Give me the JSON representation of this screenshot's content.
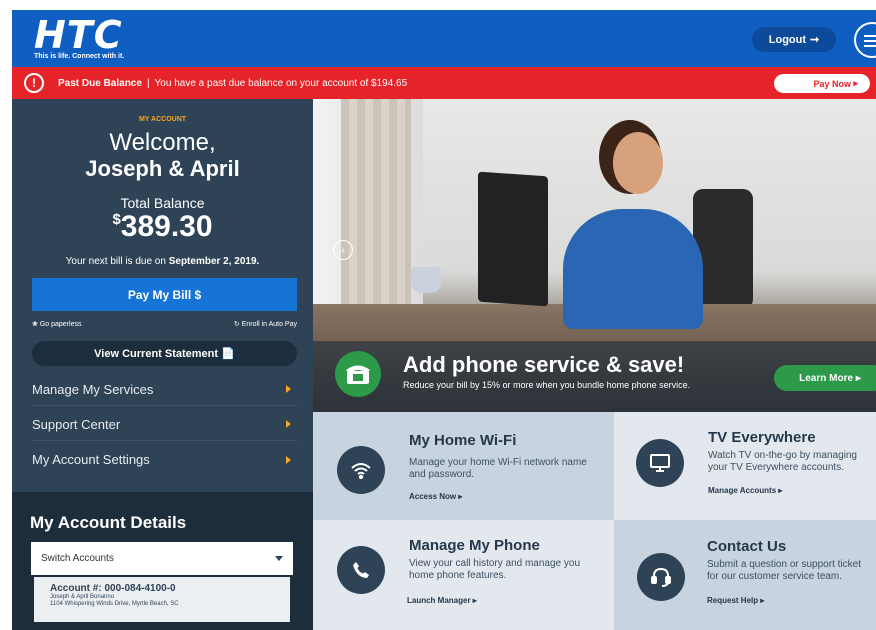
{
  "header": {
    "logo_text": "HTC",
    "tagline": "This is life. Connect with it.",
    "logout_label": "Logout"
  },
  "alert": {
    "title": "Past Due Balance",
    "separator": "|",
    "message": "You have a past due balance on your account of $194.65",
    "pay_now_label": "Pay Now"
  },
  "account": {
    "section_label": "MY ACCOUNT",
    "welcome": "Welcome,",
    "names": "Joseph & April",
    "total_balance_label": "Total Balance",
    "currency": "$",
    "total_balance": "389.30",
    "next_bill_prefix": "Your next bill is due on",
    "next_bill_date": "September 2, 2019.",
    "pay_bill_label": "Pay My Bill $",
    "paperless_label": "Go paperless",
    "autopay_label": "Enroll in Auto Pay",
    "view_statement_label": "View Current Statement"
  },
  "nav": {
    "items": [
      {
        "label": "Manage My Services"
      },
      {
        "label": "Support Center"
      },
      {
        "label": "My Account Settings"
      }
    ]
  },
  "details": {
    "title": "My Account Details",
    "switch_label": "Switch Accounts",
    "account_number": "Account #: 000-084-4100-0",
    "account_holder": "Joseph & April Bonanno",
    "account_address": "1104 Whispering Winds Drive, Myrtle Beach, SC"
  },
  "hero": {
    "title": "Add phone service & save!",
    "subtitle": "Reduce your bill by 15% or more when you bundle home phone service.",
    "cta_label": "Learn More"
  },
  "tiles": [
    {
      "title": "My Home Wi-Fi",
      "desc": "Manage your home Wi-Fi network name and password.",
      "link": "Access Now"
    },
    {
      "title": "TV Everywhere",
      "desc": "Watch TV on-the-go by managing your TV Everywhere accounts.",
      "link": "Manage Accounts"
    },
    {
      "title": "Manage My Phone",
      "desc": "View your call history and manage you home phone features.",
      "link": "Launch Manager"
    },
    {
      "title": "Contact Us",
      "desc": "Submit a question or support ticket for our customer service team.",
      "link": "Request Help"
    }
  ],
  "colors": {
    "brand_blue": "#0f5ec1",
    "alert_red": "#e52329",
    "panel_navy": "#2e4356",
    "accent_orange": "#f5a623",
    "cta_green": "#2c9a48"
  }
}
